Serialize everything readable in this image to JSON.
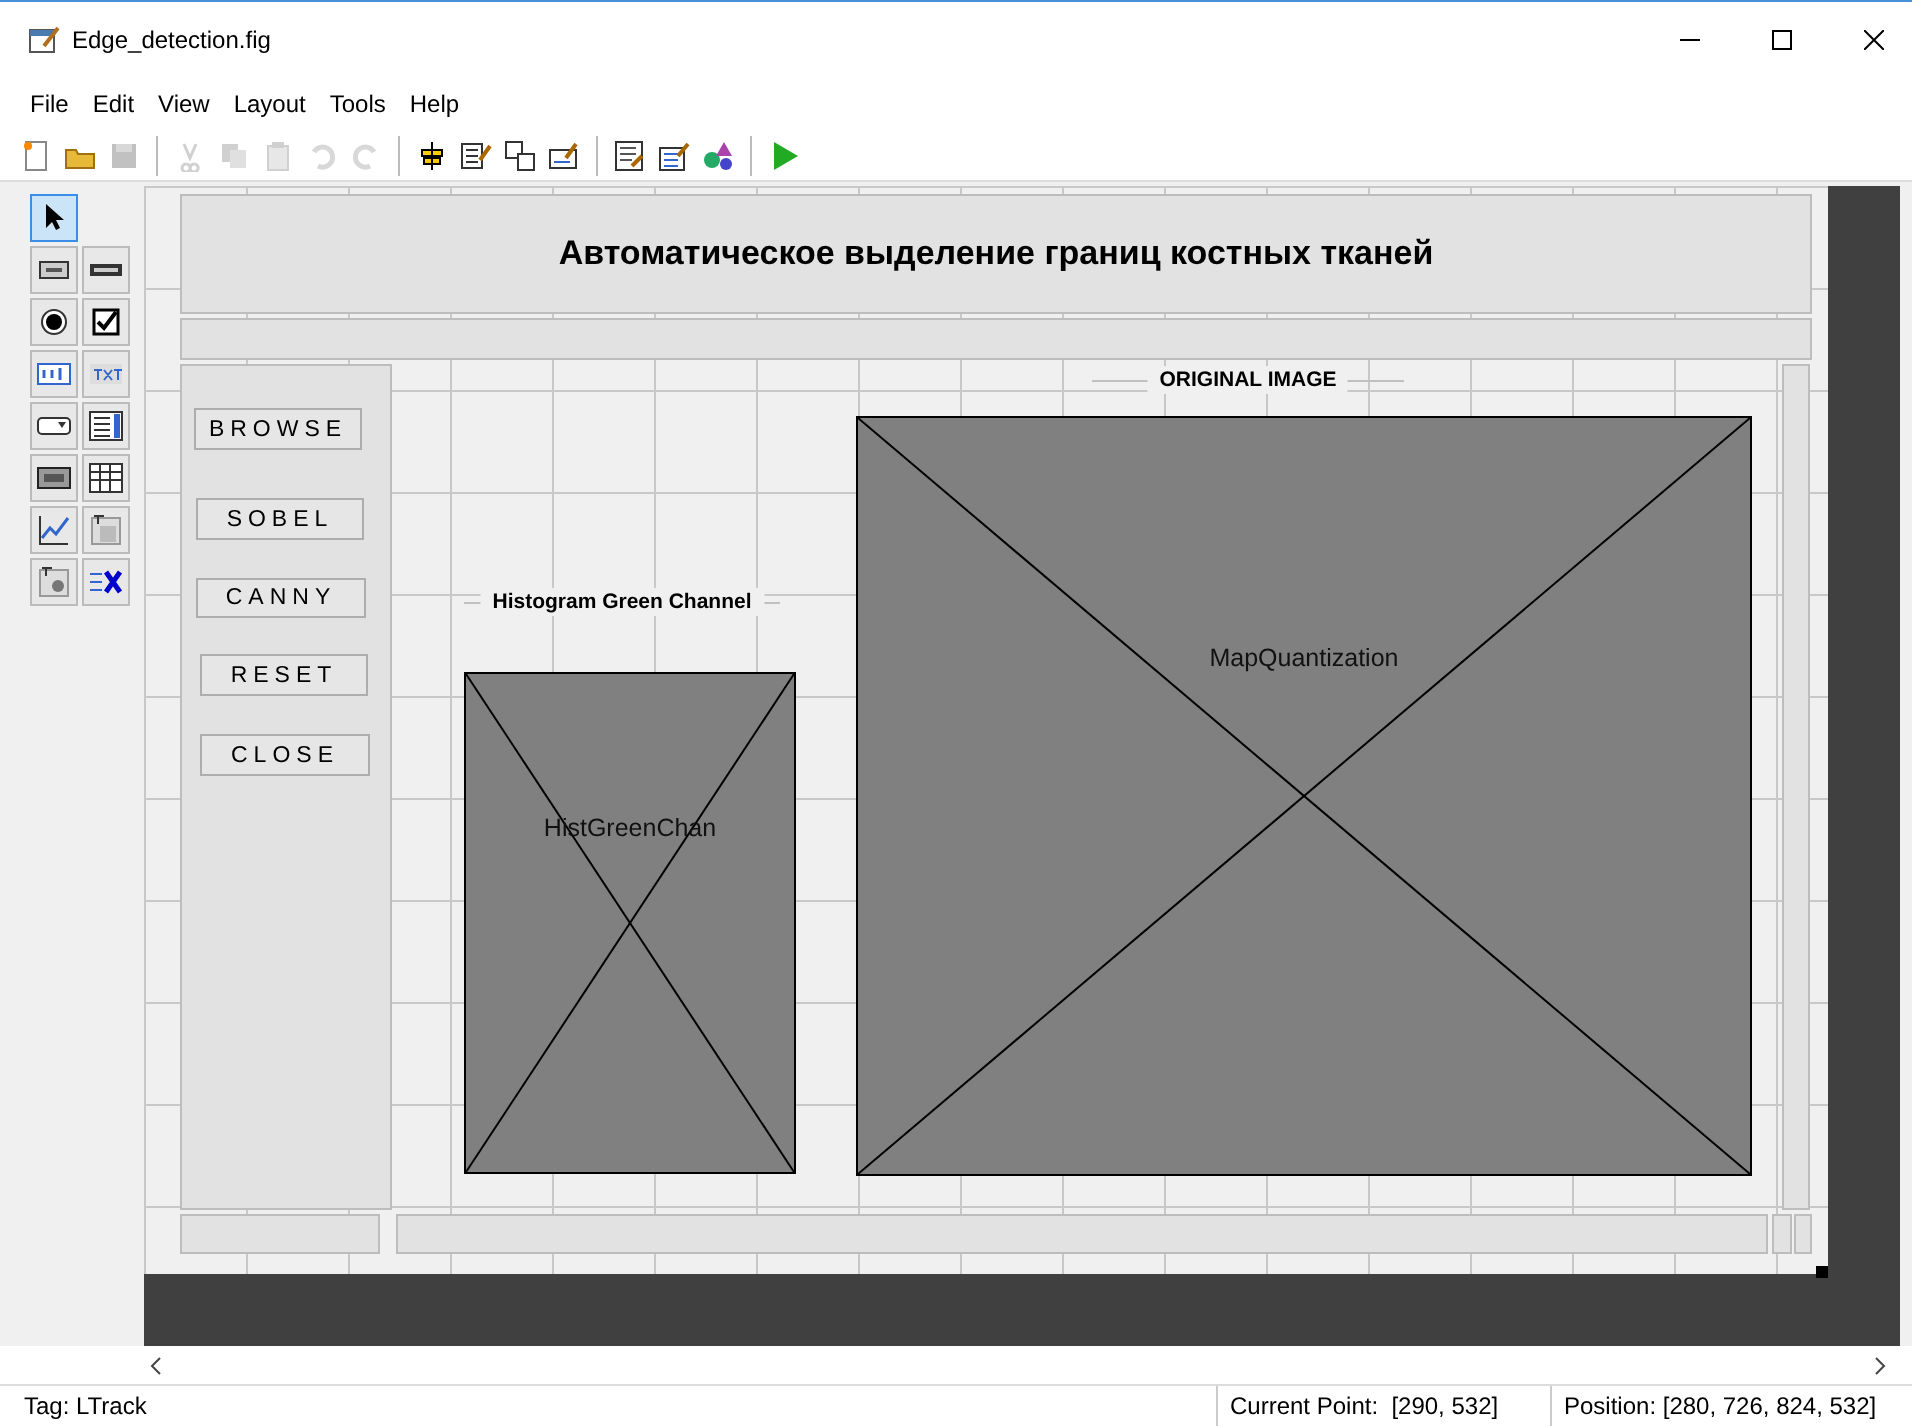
{
  "window": {
    "title": "Edge_detection.fig"
  },
  "menu": [
    "File",
    "Edit",
    "View",
    "Layout",
    "Tools",
    "Help"
  ],
  "toolbar": [
    {
      "disabled": false
    },
    {
      "disabled": false
    },
    {
      "disabled": true
    },
    {
      "disabled": true
    },
    {
      "disabled": true
    },
    {
      "disabled": true
    },
    {
      "disabled": true
    },
    {
      "disabled": true
    },
    {
      "disabled": false
    },
    {
      "disabled": false
    },
    {
      "disabled": false
    },
    {
      "disabled": false
    },
    {
      "disabled": false
    },
    {
      "disabled": false
    },
    {
      "disabled": false
    },
    {
      "disabled": false
    }
  ],
  "palette": [
    {
      "selected": true
    },
    {
      "selected": false
    },
    {
      "selected": false
    },
    {
      "selected": false
    },
    {
      "selected": false
    },
    {
      "selected": false
    },
    {
      "selected": false
    },
    {
      "selected": false
    },
    {
      "selected": false
    },
    {
      "selected": false
    },
    {
      "selected": false
    },
    {
      "selected": false
    },
    {
      "selected": false
    },
    {
      "selected": false
    },
    {
      "selected": false
    }
  ],
  "figure": {
    "title": "Автоматическое выделение границ костных тканей",
    "buttons": [
      "BROWSE",
      "SOBEL",
      "CANNY",
      "RESET",
      "CLOSE"
    ],
    "axes": [
      {
        "panel_title": "Histogram Green Channel",
        "label": "HistGreenChan"
      },
      {
        "panel_title": "ORIGINAL IMAGE",
        "label": "MapQuantization"
      }
    ]
  },
  "status_bar": {
    "tag": "Tag: LTrack",
    "current_point": "Current Point:  [290, 532]",
    "position": "Position: [280, 726, 824, 532]"
  }
}
